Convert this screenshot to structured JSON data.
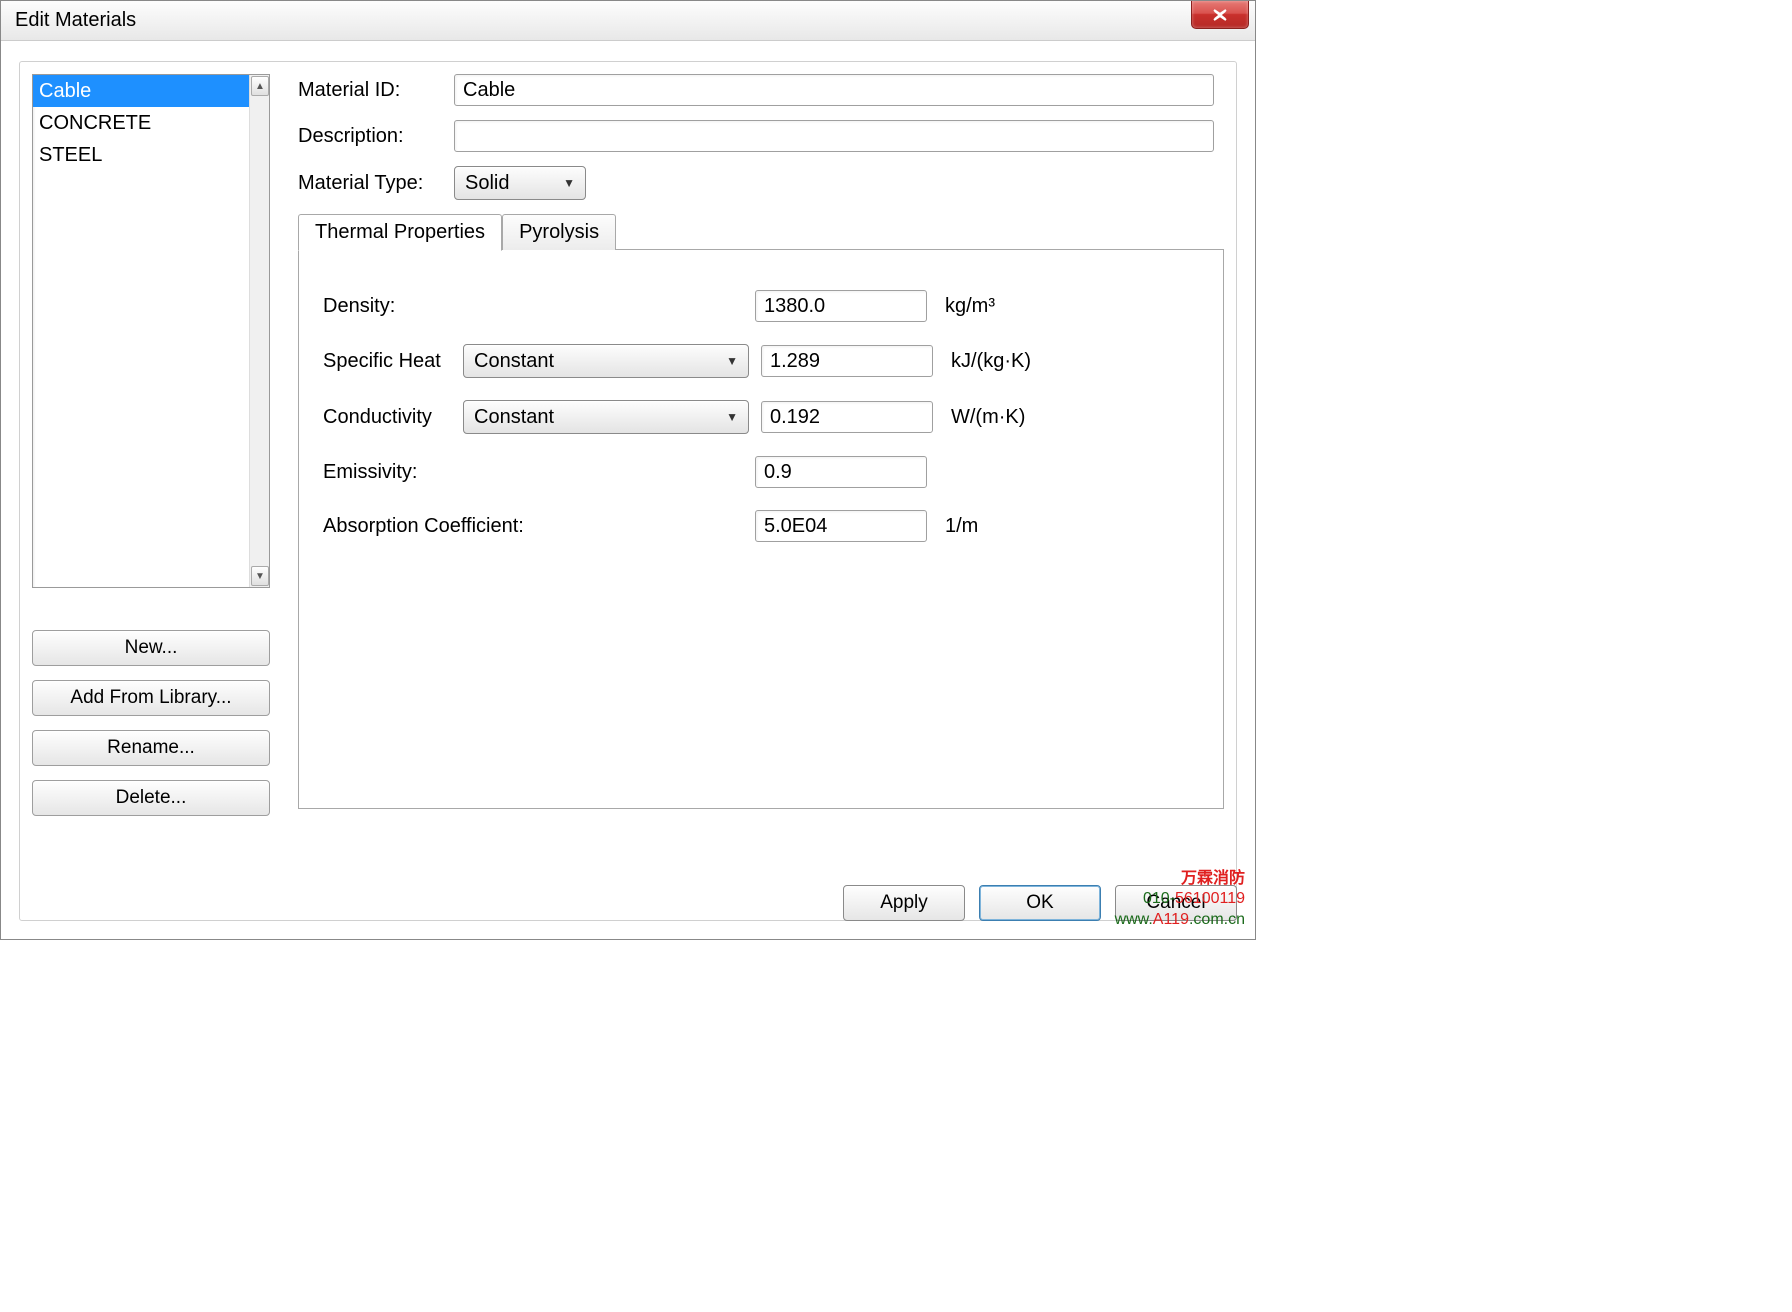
{
  "window": {
    "title": "Edit Materials"
  },
  "list": {
    "items": [
      "Cable",
      "CONCRETE",
      "STEEL"
    ],
    "selected_index": 0
  },
  "side_buttons": {
    "new": "New...",
    "add_lib": "Add From Library...",
    "rename": "Rename...",
    "delete": "Delete..."
  },
  "fields": {
    "material_id_label": "Material ID:",
    "material_id_value": "Cable",
    "description_label": "Description:",
    "description_value": "",
    "material_type_label": "Material Type:",
    "material_type_value": "Solid"
  },
  "tabs": {
    "thermal": "Thermal Properties",
    "pyrolysis": "Pyrolysis"
  },
  "thermal": {
    "density_label": "Density:",
    "density_value": "1380.0",
    "density_unit": "kg/m³",
    "specific_heat_label": "Specific Heat",
    "specific_heat_mode": "Constant",
    "specific_heat_value": "1.289",
    "specific_heat_unit": "kJ/(kg·K)",
    "conductivity_label": "Conductivity",
    "conductivity_mode": "Constant",
    "conductivity_value": "0.192",
    "conductivity_unit": "W/(m·K)",
    "emissivity_label": "Emissivity:",
    "emissivity_value": "0.9",
    "absorption_label": "Absorption Coefficient:",
    "absorption_value": "5.0E04",
    "absorption_unit": "1/m"
  },
  "buttons": {
    "apply": "Apply",
    "ok": "OK",
    "cancel": "Cancel"
  },
  "watermark": {
    "line1": "万霖消防",
    "line2a": "010-",
    "line2b": "56100119",
    "line3a": "www.",
    "line3b": "A119",
    "line3c": ".com.cn"
  }
}
